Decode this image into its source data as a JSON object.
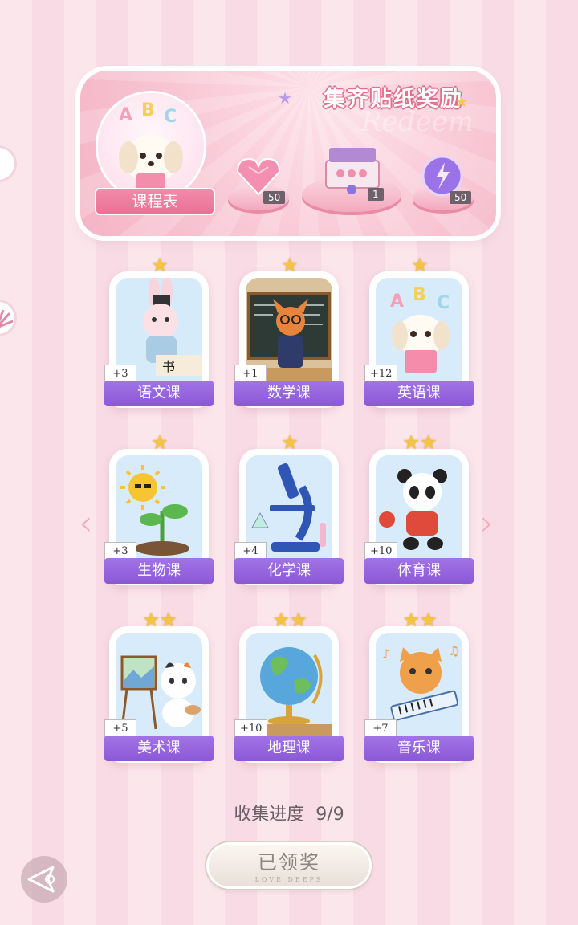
{
  "banner": {
    "title": "集齐贴纸奖励",
    "watermark": "Redeem",
    "schedule_label": "课程表",
    "schedule_book_text": "ABC",
    "rewards": [
      {
        "icon": "pink-heart-gem-icon",
        "count": "50"
      },
      {
        "icon": "gift-box-icon",
        "count": "1"
      },
      {
        "icon": "purple-orb-icon",
        "count": "50"
      }
    ]
  },
  "courses": [
    {
      "name": "语文课",
      "plus": "+3",
      "stars": "★",
      "art": "bunny-calligraphy-icon"
    },
    {
      "name": "数学课",
      "plus": "+1",
      "stars": "★",
      "art": "fox-teacher-icon"
    },
    {
      "name": "英语课",
      "plus": "+12",
      "stars": "★",
      "art": "puppy-abc-icon",
      "art_text": "ABC"
    },
    {
      "name": "生物课",
      "plus": "+3",
      "stars": "★",
      "art": "sun-sprout-icon"
    },
    {
      "name": "化学课",
      "plus": "+4",
      "stars": "★",
      "art": "microscope-icon"
    },
    {
      "name": "体育课",
      "plus": "+10",
      "stars": "★★",
      "art": "panda-pingpong-icon"
    },
    {
      "name": "美术课",
      "plus": "+5",
      "stars": "★★",
      "art": "cat-painter-icon"
    },
    {
      "name": "地理课",
      "plus": "+10",
      "stars": "★★",
      "art": "globe-icon"
    },
    {
      "name": "音乐课",
      "plus": "+7",
      "stars": "★★",
      "art": "cat-keyboard-icon"
    }
  ],
  "progress": {
    "label": "收集进度",
    "value": "9/9"
  },
  "claim_button": {
    "label": "已领奖",
    "sub": "LOVE DEEPS"
  },
  "colors": {
    "accent": "#8b58d6",
    "banner": "#f4b4c6",
    "star": "#f5c542"
  }
}
